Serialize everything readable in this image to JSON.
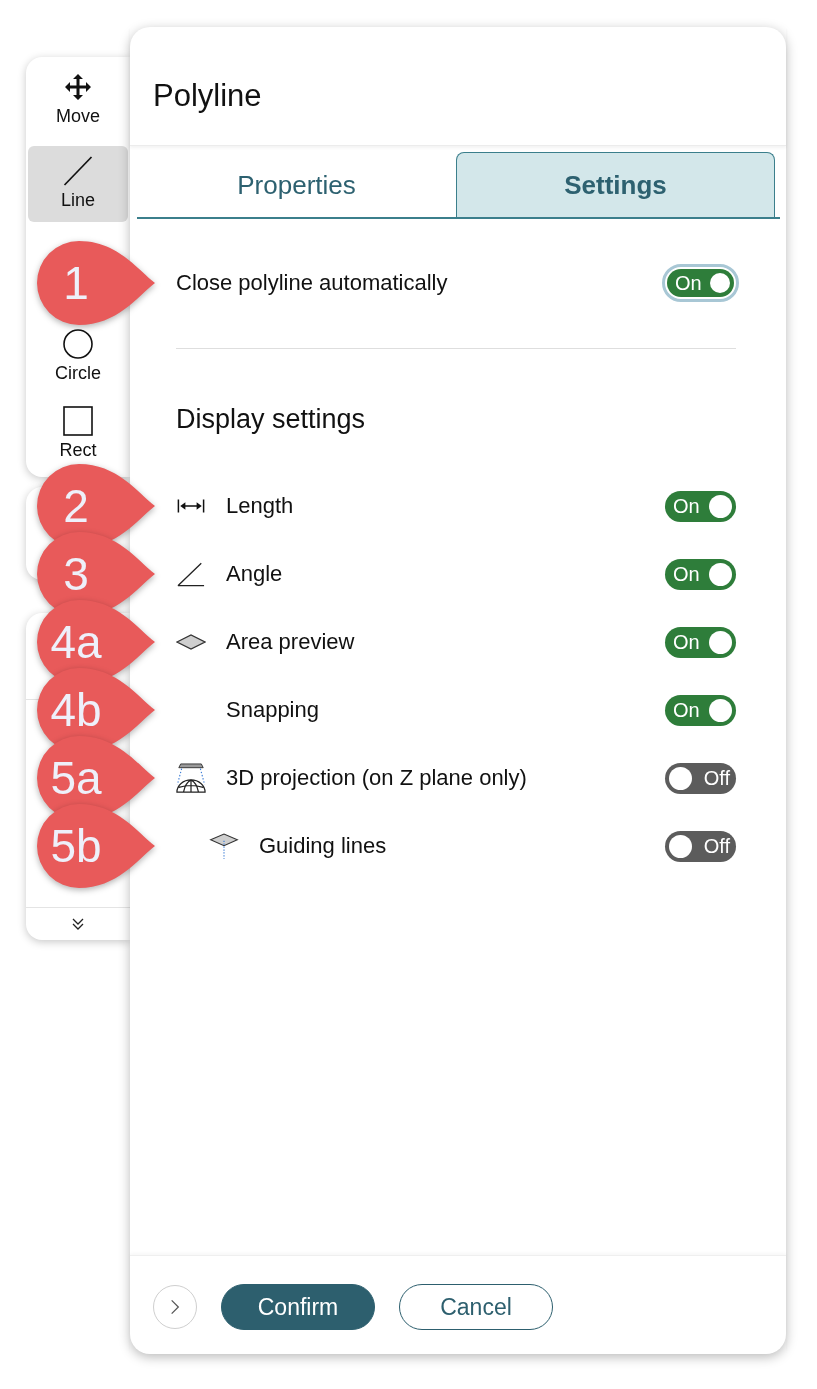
{
  "toolbar": {
    "tools": [
      {
        "label": "Move",
        "selected": false
      },
      {
        "label": "Line",
        "selected": true
      },
      {
        "label": "Circle",
        "selected": false
      },
      {
        "label": "Rect",
        "selected": false
      }
    ]
  },
  "panel": {
    "title": "Polyline",
    "tabs": [
      {
        "label": "Properties",
        "selected": false
      },
      {
        "label": "Settings",
        "selected": true
      }
    ],
    "settings": [
      {
        "label": "Close polyline automatically",
        "on": true,
        "state_label": "On",
        "focused": true,
        "callout": "1"
      }
    ],
    "display_settings": {
      "heading": "Display settings",
      "items": [
        {
          "label": "Length",
          "on": true,
          "state_label": "On",
          "callout": "2"
        },
        {
          "label": "Angle",
          "on": true,
          "state_label": "On",
          "callout": "3"
        },
        {
          "label": "Area preview",
          "on": true,
          "state_label": "On",
          "callout": "4a"
        },
        {
          "label": "Snapping",
          "on": true,
          "state_label": "On",
          "callout": "4b"
        },
        {
          "label": "3D projection (on Z plane only)",
          "on": false,
          "state_label": "Off",
          "callout": "5a",
          "children": [
            {
              "label": "Guiding lines",
              "on": false,
              "state_label": "Off",
              "callout": "5b"
            }
          ]
        }
      ]
    },
    "footer": {
      "buttons": [
        {
          "label": "Confirm",
          "kind": "primary"
        },
        {
          "label": "Cancel",
          "kind": "secondary"
        }
      ]
    }
  }
}
